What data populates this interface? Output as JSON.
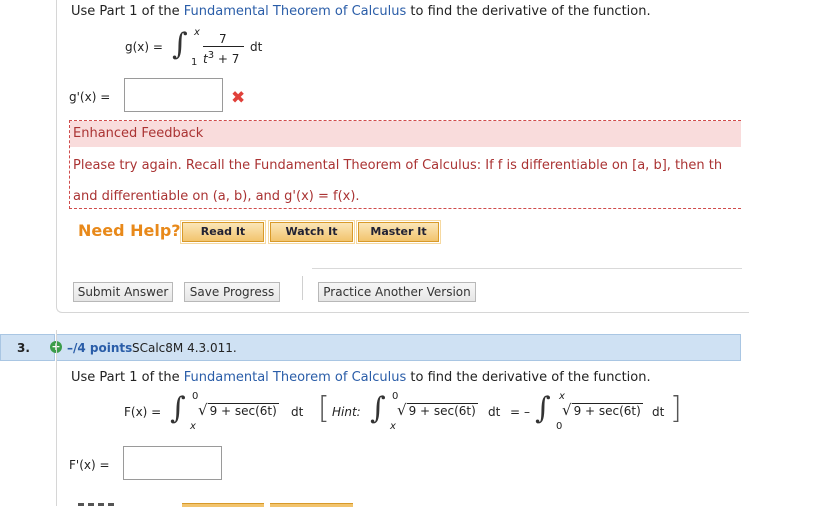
{
  "q2": {
    "instruction_pre": "Use Part 1 of the ",
    "instruction_link": "Fundamental Theorem of Calculus",
    "instruction_post": " to find the derivative of the function.",
    "function_lhs": "g(x) =",
    "integral_upper": "x",
    "integral_lower": "1",
    "fraction_numerator": "7",
    "fraction_denominator_base": "t",
    "fraction_denominator_exp": "3",
    "fraction_denominator_rest": " + 7",
    "differential": "dt",
    "answer_label": "g'(x) =",
    "answer_value": "",
    "feedback": {
      "heading": "Enhanced Feedback",
      "line1": "Please try again. Recall the Fundamental Theorem of Calculus: If f is differentiable on  [a, b],  then th",
      "line2": "and differentiable on  (a, b),  and  g'(x) = f(x)."
    },
    "need_help": "Need Help?",
    "help_buttons": [
      "Read It",
      "Watch It",
      "Master It"
    ],
    "submit_answer": "Submit Answer",
    "save_progress": "Save Progress",
    "practice_another": "Practice Another Version"
  },
  "q3": {
    "number": "3.",
    "points": "–/4 points",
    "code": "SCalc8M 4.3.011.",
    "instruction_pre": "Use Part 1 of the ",
    "instruction_link": "Fundamental Theorem of Calculus",
    "instruction_post": " to find the derivative of the function.",
    "function_lhs": "F(x) =",
    "integral_upper": "0",
    "integral_lower": "x",
    "integrand": "9 + sec(6t)",
    "differential": "dt",
    "hint_label": "Hint:",
    "hint_equals": "=",
    "hint_minus": "–",
    "hint_upper2": "x",
    "hint_lower2": "0",
    "answer_label": "F'(x) ="
  },
  "colors": {
    "link": "#2a5da8",
    "error": "#e0403a",
    "feedback_bg": "#f9dcdc",
    "help_orange": "#e8891a",
    "question_bar": "#cfe1f3"
  }
}
